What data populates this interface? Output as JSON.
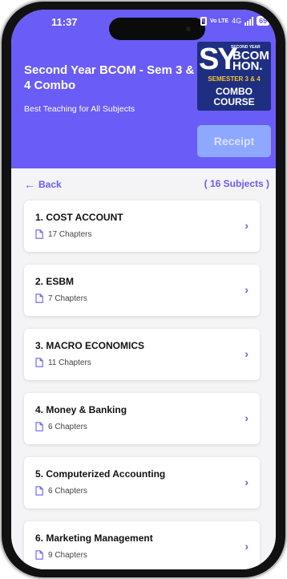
{
  "status": {
    "time": "11:37",
    "network": "Vo LTE",
    "signal": "4G",
    "battery": "69"
  },
  "course": {
    "title": "Second Year BCOM - Sem 3 & 4 Combo",
    "subtitle": "Best Teaching for All Subjects",
    "thumbnail": {
      "sy": "SY",
      "second_year": "SECOND YEAR",
      "bcom": "BCOM",
      "hon": "HON.",
      "semester": "SEMESTER 3 & 4",
      "combo": "COMBO",
      "course": "COURSE"
    },
    "receipt_label": "Receipt"
  },
  "nav": {
    "back_label": "Back",
    "subject_count": "( 16 Subjects )"
  },
  "subjects": [
    {
      "title": "1. COST ACCOUNT",
      "chapters": "17 Chapters"
    },
    {
      "title": "2. ESBM",
      "chapters": "7 Chapters"
    },
    {
      "title": "3. MACRO ECONOMICS",
      "chapters": "11 Chapters"
    },
    {
      "title": "4. Money & Banking",
      "chapters": "6 Chapters"
    },
    {
      "title": "5. Computerized Accounting",
      "chapters": "6 Chapters"
    },
    {
      "title": "6. Marketing Management",
      "chapters": "9 Chapters"
    }
  ],
  "colors": {
    "accent": "#6a5cf6",
    "receipt": "#8fa8ff",
    "thumb_bg": "#1e2e80"
  },
  "icons": {
    "back": "arrow-left-icon",
    "chapters": "document-icon",
    "open": "chevron-right-icon"
  }
}
